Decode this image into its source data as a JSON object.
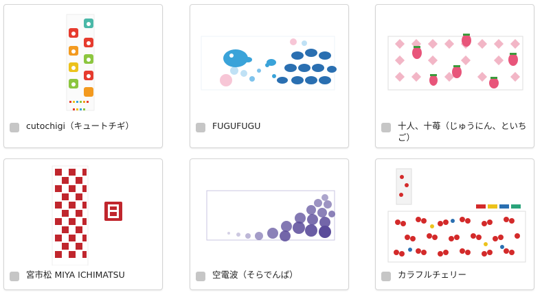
{
  "items": [
    {
      "label": "cutochigi（キュートチギ）",
      "icon": "checkbox",
      "accent": "#e63b2e"
    },
    {
      "label": "FUGUFUGU",
      "icon": "checkbox",
      "accent": "#3aa3d9"
    },
    {
      "label": "十人、十苺（じゅうにん、といちご）",
      "icon": "checkbox",
      "accent": "#e8557a"
    },
    {
      "label": "宮市松 MIYA ICHIMATSU",
      "icon": "checkbox",
      "accent": "#c0262d"
    },
    {
      "label": "空電波（そらでんぱ）",
      "icon": "checkbox",
      "accent": "#5a4b9a"
    },
    {
      "label": "カラフルチェリー",
      "icon": "checkbox",
      "accent": "#d32a2a"
    }
  ],
  "seal_glyph": "宮"
}
